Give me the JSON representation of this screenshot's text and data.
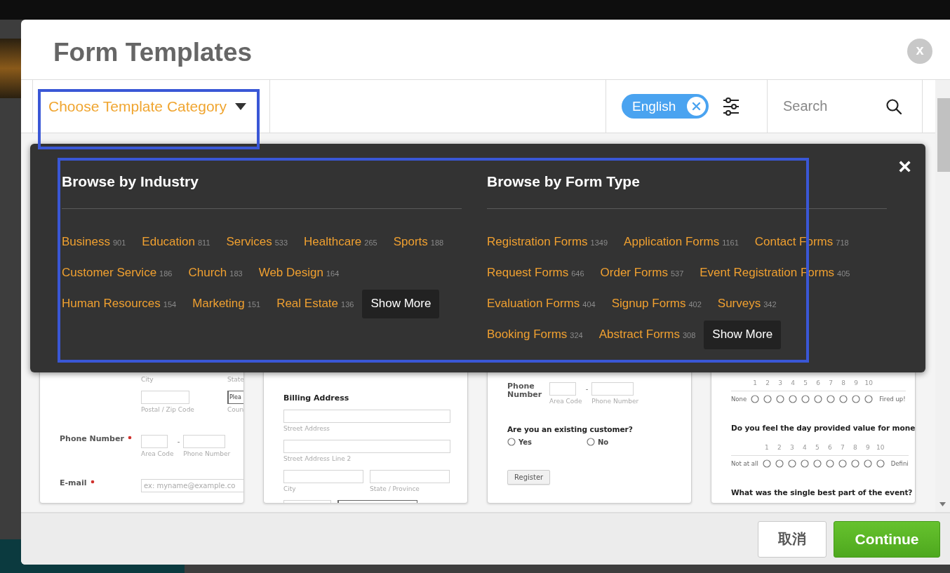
{
  "modal": {
    "title": "Form Templates",
    "close": "x"
  },
  "toolbar": {
    "category": {
      "label": "Choose Template Category",
      "highlighted": true
    },
    "language": {
      "label": "English"
    },
    "search": {
      "placeholder": "Search"
    }
  },
  "browse_panel": {
    "highlighted": true,
    "close": "×",
    "sections": [
      {
        "title": "Browse by Industry",
        "rows": [
          [
            {
              "label": "Business",
              "count": "901"
            },
            {
              "label": "Education",
              "count": "811"
            },
            {
              "label": "Services",
              "count": "533"
            },
            {
              "label": "Healthcare",
              "count": "265"
            },
            {
              "label": "Sports",
              "count": "188"
            }
          ],
          [
            {
              "label": "Customer Service",
              "count": "186"
            },
            {
              "label": "Church",
              "count": "183"
            },
            {
              "label": "Web Design",
              "count": "164"
            }
          ],
          [
            {
              "label": "Human Resources",
              "count": "154"
            },
            {
              "label": "Marketing",
              "count": "151"
            },
            {
              "label": "Real Estate",
              "count": "136"
            }
          ]
        ],
        "show_more": "Show More"
      },
      {
        "title": "Browse by Form Type",
        "rows": [
          [
            {
              "label": "Registration Forms",
              "count": "1349"
            },
            {
              "label": "Application Forms",
              "count": "1161"
            },
            {
              "label": "Contact Forms",
              "count": "718"
            }
          ],
          [
            {
              "label": "Request Forms",
              "count": "646"
            },
            {
              "label": "Order Forms",
              "count": "537"
            },
            {
              "label": "Event Registration Forms",
              "count": "405"
            }
          ],
          [
            {
              "label": "Evaluation Forms",
              "count": "404"
            },
            {
              "label": "Signup Forms",
              "count": "402"
            },
            {
              "label": "Surveys",
              "count": "342"
            }
          ],
          [
            {
              "label": "Booking Forms",
              "count": "324"
            },
            {
              "label": "Abstract Forms",
              "count": "308"
            }
          ]
        ],
        "show_more": "Show More"
      }
    ]
  },
  "cards": [
    {
      "rows": [
        {
          "kind": "fields",
          "fields": [
            {
              "kind": "caption",
              "caption": "City"
            },
            {
              "kind": "caption",
              "caption": "State"
            }
          ]
        },
        {
          "kind": "fields",
          "fields": [
            {
              "kind": "text",
              "caption": "Postal / Zip Code"
            },
            {
              "kind": "select",
              "caption": "Coun",
              "value": "Plea"
            }
          ]
        },
        {
          "kind": "fields",
          "label": "Phone Number",
          "required": true,
          "separator": "-",
          "fields": [
            {
              "kind": "text",
              "caption": "Area Code"
            },
            {
              "kind": "text",
              "caption": "Phone Number"
            }
          ]
        },
        {
          "kind": "fields",
          "label": "E-mail",
          "required": true,
          "fields": [
            {
              "kind": "text",
              "placeholder": "ex: myname@example.co"
            }
          ]
        }
      ]
    },
    {
      "rows": [
        {
          "kind": "heading",
          "text": "Billing Address"
        },
        {
          "kind": "fields",
          "fields": [
            {
              "kind": "text",
              "caption": "Street Address"
            }
          ]
        },
        {
          "kind": "fields",
          "fields": [
            {
              "kind": "text",
              "caption": "Street Address Line 2"
            }
          ]
        },
        {
          "kind": "fields",
          "fields": [
            {
              "kind": "text",
              "caption": "City"
            },
            {
              "kind": "text",
              "caption": "State / Province"
            }
          ]
        },
        {
          "kind": "fields",
          "fields": [
            {
              "kind": "text"
            },
            {
              "kind": "select"
            }
          ]
        }
      ]
    },
    {
      "rows": [
        {
          "kind": "fields",
          "label": "Phone Number",
          "separator": "-",
          "fields": [
            {
              "kind": "text",
              "caption": "Area Code"
            },
            {
              "kind": "text",
              "caption": "Phone Number"
            }
          ]
        },
        {
          "kind": "question",
          "text": "Are you an existing customer?"
        },
        {
          "kind": "radios",
          "options": [
            {
              "label": "Yes",
              "checked": false
            },
            {
              "label": "No",
              "checked": false
            }
          ]
        },
        {
          "kind": "button",
          "label": "Register"
        }
      ]
    },
    {
      "rows": [
        {
          "kind": "scale",
          "low": "None",
          "high": "Fired up!",
          "options": [
            {
              "label": "1",
              "checked": false
            },
            {
              "label": "2",
              "checked": false
            },
            {
              "label": "3",
              "checked": false
            },
            {
              "label": "4",
              "checked": false
            },
            {
              "label": "5",
              "checked": false
            },
            {
              "label": "6",
              "checked": false
            },
            {
              "label": "7",
              "checked": false
            },
            {
              "label": "8",
              "checked": false
            },
            {
              "label": "9",
              "checked": false
            },
            {
              "label": "10",
              "checked": false
            }
          ]
        },
        {
          "kind": "question",
          "text": "Do you feel the day provided value for mone"
        },
        {
          "kind": "scale",
          "low": "Not at all",
          "high": "Defini",
          "options": [
            {
              "label": "1",
              "checked": false
            },
            {
              "label": "2",
              "checked": false
            },
            {
              "label": "3",
              "checked": false
            },
            {
              "label": "4",
              "checked": false
            },
            {
              "label": "5",
              "checked": false
            },
            {
              "label": "6",
              "checked": false
            },
            {
              "label": "7",
              "checked": false
            },
            {
              "label": "8",
              "checked": false
            },
            {
              "label": "9",
              "checked": false
            },
            {
              "label": "10",
              "checked": false
            }
          ]
        },
        {
          "kind": "question",
          "text": "What was the single best part of the event?"
        }
      ]
    }
  ],
  "footer": {
    "buttons": [
      {
        "label": "取消",
        "kind": "secondary"
      },
      {
        "label": "Continue",
        "kind": "primary"
      }
    ]
  }
}
